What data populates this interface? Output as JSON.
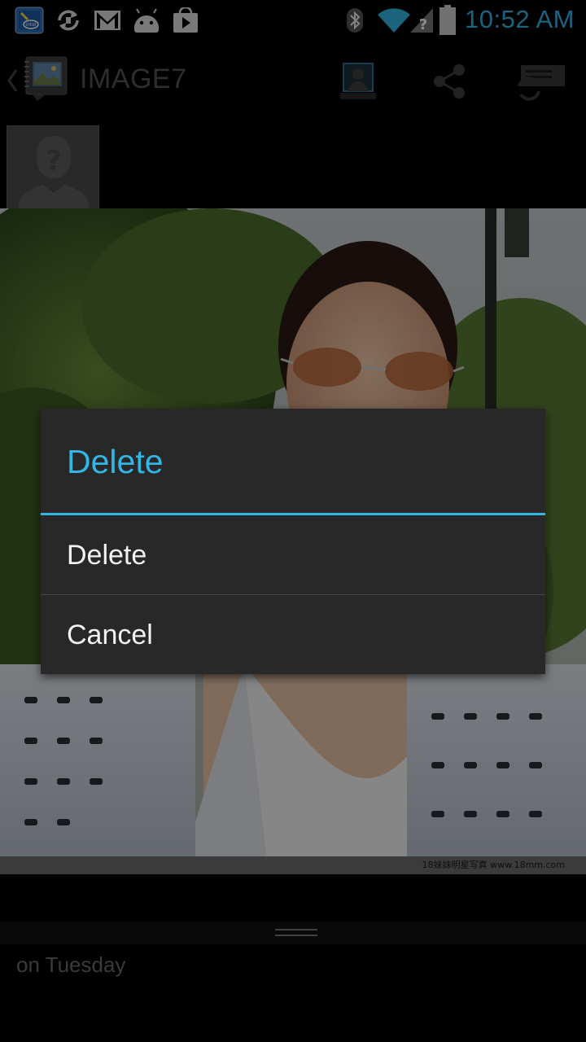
{
  "status_bar": {
    "time": "10:52 AM",
    "icons": [
      "intel-app-icon",
      "sync-icon",
      "gmail-icon",
      "android-icon",
      "play-store-icon",
      "bluetooth-icon",
      "wifi-icon",
      "no-signal-icon",
      "battery-icon"
    ]
  },
  "action_bar": {
    "title": "IMAGE7",
    "buttons": [
      "contact-icon",
      "share-icon",
      "slideshow-icon"
    ]
  },
  "photo": {
    "watermark": "18妹妹明星写真 www.18mm.com"
  },
  "bottom_panel": {
    "text": "on Tuesday"
  },
  "dialog": {
    "title": "Delete",
    "items": [
      {
        "label": "Delete"
      },
      {
        "label": "Cancel"
      }
    ]
  },
  "colors": {
    "accent": "#33b5e5",
    "dialog_bg": "#282828"
  }
}
